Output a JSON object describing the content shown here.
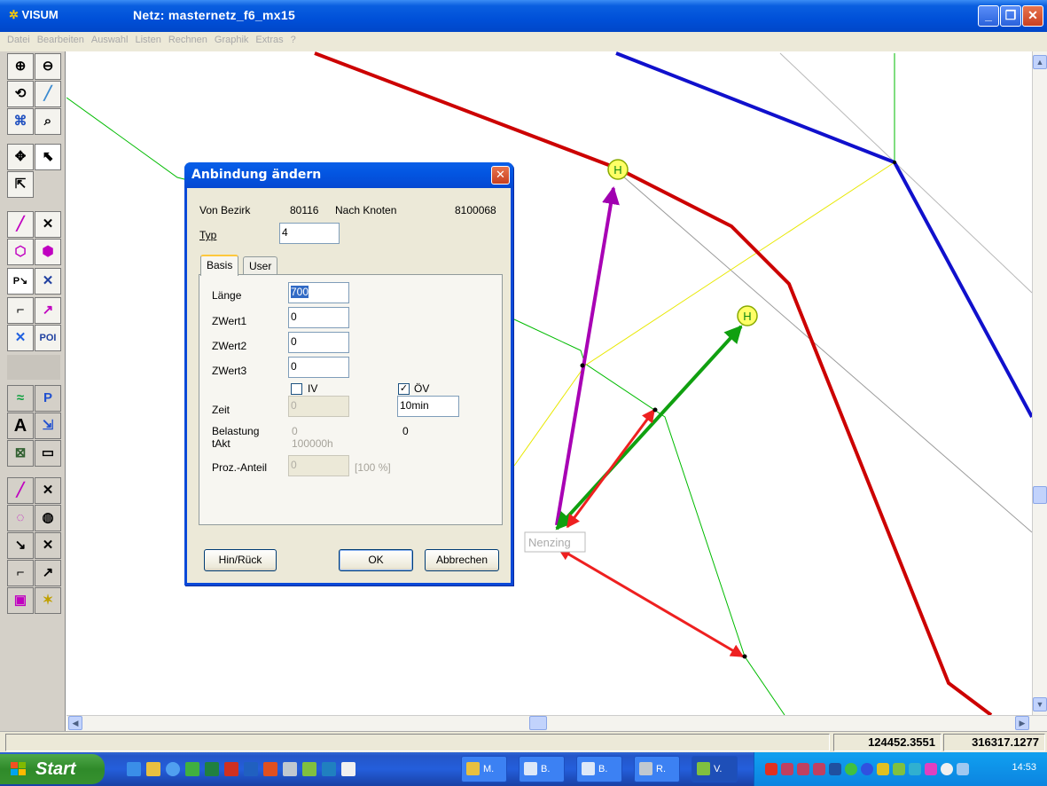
{
  "window": {
    "app_name": "VISUM",
    "title": "Netz: masternetz_f6_mx15"
  },
  "menu": [
    "Datei",
    "Bearbeiten",
    "Auswahl",
    "Listen",
    "Rechnen",
    "Graphik",
    "Extras",
    "?"
  ],
  "map": {
    "stop_marker_label": "H",
    "location_label": "Nenzing"
  },
  "dialog": {
    "title": "Anbindung ändern",
    "von_bezirk_label": "Von Bezirk",
    "von_bezirk_value": "80116",
    "nach_knoten_label": "Nach Knoten",
    "nach_knoten_value": "8100068",
    "typ_label": "Typ",
    "typ_value": "4",
    "tabs": [
      "Basis",
      "User"
    ],
    "fields": {
      "laenge_label": "Länge",
      "laenge_value": "700",
      "zwert1_label": "ZWert1",
      "zwert1_value": "0",
      "zwert2_label": "ZWert2",
      "zwert2_value": "0",
      "zwert3_label": "ZWert3",
      "zwert3_value": "0",
      "iv_label": "IV",
      "iv_checked": false,
      "ov_label": "ÖV",
      "ov_checked": true,
      "zeit_label": "Zeit",
      "zeit_iv_value": "0",
      "zeit_ov_value": "10min",
      "belastung_label": "Belastung",
      "belastung_iv_value": "0",
      "belastung_ov_value": "0",
      "takt_label": "tAkt",
      "takt_value": "100000h",
      "proz_anteil_label": "Proz.-Anteil",
      "proz_anteil_value": "0",
      "proz_anteil_unit": "[100 %]"
    },
    "buttons": {
      "hin_rueck": "Hin/Rück",
      "ok": "OK",
      "abbrechen": "Abbrechen"
    }
  },
  "status": {
    "coord_x": "124452.3551",
    "coord_y": "316317.1277"
  },
  "taskbar": {
    "start_label": "Start",
    "tasks": [
      "M.",
      "B.",
      "B.",
      "R.",
      "V."
    ],
    "clock": "14:53"
  },
  "colors": {
    "line_red": "#cc0000",
    "line_blue": "#0000cc",
    "line_green": "#00aa00",
    "arrow_purple": "#b000b8",
    "connector_yellow": "#eeee00"
  }
}
